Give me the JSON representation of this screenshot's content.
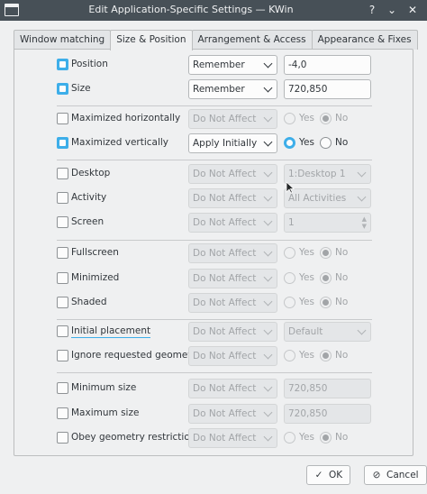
{
  "window": {
    "title": "Edit Application-Specific Settings — KWin",
    "help_icon": "?",
    "minimize_icon": "⌄",
    "close_icon": "✕"
  },
  "tabs": [
    {
      "label": "Window matching",
      "active": false
    },
    {
      "label": "Size & Position",
      "active": true
    },
    {
      "label": "Arrangement & Access",
      "active": false
    },
    {
      "label": "Appearance & Fixes",
      "active": false
    }
  ],
  "rows": {
    "position": {
      "label": "Position",
      "checked": true,
      "policy": "Remember",
      "value": "-4,0"
    },
    "size": {
      "label": "Size",
      "checked": true,
      "policy": "Remember",
      "value": "720,850"
    },
    "max_h": {
      "label": "Maximized horizontally",
      "checked": false,
      "policy": "Do Not Affect",
      "yes": "Yes",
      "no": "No"
    },
    "max_v": {
      "label": "Maximized vertically",
      "checked": true,
      "policy": "Apply Initially",
      "yes": "Yes",
      "no": "No"
    },
    "desktop": {
      "label": "Desktop",
      "checked": false,
      "policy": "Do Not Affect",
      "value": "1:Desktop 1"
    },
    "activity": {
      "label": "Activity",
      "checked": false,
      "policy": "Do Not Affect",
      "value": "All Activities"
    },
    "screen": {
      "label": "Screen",
      "checked": false,
      "policy": "Do Not Affect",
      "value": "1"
    },
    "fullscreen": {
      "label": "Fullscreen",
      "checked": false,
      "policy": "Do Not Affect",
      "yes": "Yes",
      "no": "No"
    },
    "minimized": {
      "label": "Minimized",
      "checked": false,
      "policy": "Do Not Affect",
      "yes": "Yes",
      "no": "No"
    },
    "shaded": {
      "label": "Shaded",
      "checked": false,
      "policy": "Do Not Affect",
      "yes": "Yes",
      "no": "No"
    },
    "initial_placement": {
      "label": "Initial placement",
      "checked": false,
      "policy": "Do Not Affect",
      "value": "Default"
    },
    "ignore_geometry": {
      "label": "Ignore requested geometry",
      "checked": false,
      "policy": "Do Not Affect",
      "yes": "Yes",
      "no": "No"
    },
    "min_size": {
      "label": "Minimum size",
      "checked": false,
      "policy": "Do Not Affect",
      "value": "720,850"
    },
    "max_size": {
      "label": "Maximum size",
      "checked": false,
      "policy": "Do Not Affect",
      "value": "720,850"
    },
    "obey_geometry": {
      "label": "Obey geometry restrictions",
      "checked": false,
      "policy": "Do Not Affect",
      "yes": "Yes",
      "no": "No"
    }
  },
  "buttons": {
    "ok": "OK",
    "cancel": "Cancel",
    "ok_icon": "✓",
    "cancel_icon": "⊘"
  },
  "colors": {
    "accent": "#3daee9",
    "titlebar": "#475057",
    "background": "#eff0f1"
  }
}
